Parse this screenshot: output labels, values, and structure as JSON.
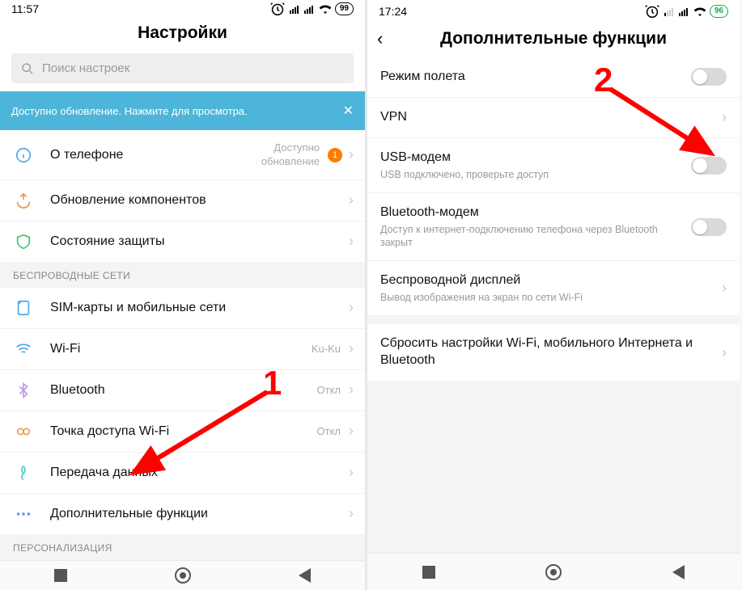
{
  "left": {
    "status": {
      "time": "11:57",
      "battery": "99"
    },
    "title": "Настройки",
    "search_placeholder": "Поиск настроек",
    "banner": {
      "text": "Доступно обновление. Нажмите для просмотра.",
      "close": "✕"
    },
    "rows_top": [
      {
        "icon": "info",
        "label": "О телефоне",
        "sub": "Доступно\nобновление",
        "badge": "1"
      },
      {
        "icon": "update",
        "label": "Обновление компонентов"
      },
      {
        "icon": "shield",
        "label": "Состояние защиты"
      }
    ],
    "section_net": "БЕСПРОВОДНЫЕ СЕТИ",
    "rows_net": [
      {
        "icon": "sim",
        "label": "SIM-карты и мобильные сети"
      },
      {
        "icon": "wifi",
        "label": "Wi-Fi",
        "sub": "Ku-Ku"
      },
      {
        "icon": "bt",
        "label": "Bluetooth",
        "sub": "Откл"
      },
      {
        "icon": "hotspot",
        "label": "Точка доступа Wi-Fi",
        "sub": "Откл"
      },
      {
        "icon": "data",
        "label": "Передача данных"
      },
      {
        "icon": "more",
        "label": "Дополнительные функции"
      }
    ],
    "section_pers": "ПЕРСОНАЛИЗАЦИЯ"
  },
  "right": {
    "status": {
      "time": "17:24",
      "battery": "96"
    },
    "title": "Дополнительные функции",
    "rows": [
      {
        "title": "Режим полета",
        "ctrl": "toggle"
      },
      {
        "title": "VPN",
        "ctrl": "chev"
      },
      {
        "title": "USB-модем",
        "desc": "USB подключено, проверьте доступ",
        "ctrl": "toggle"
      },
      {
        "title": "Bluetooth-модем",
        "desc": "Доступ к интернет-подключению телефона через Bluetooth закрыт",
        "ctrl": "toggle"
      },
      {
        "title": "Беспроводной дисплей",
        "desc": "Вывод изображения на экран по сети Wi-Fi",
        "ctrl": "chev"
      },
      {
        "title": "Сбросить настройки Wi-Fi, мобильного Интернета и Bluetooth",
        "ctrl": "chev"
      }
    ]
  },
  "annotations": {
    "one": "1",
    "two": "2"
  }
}
